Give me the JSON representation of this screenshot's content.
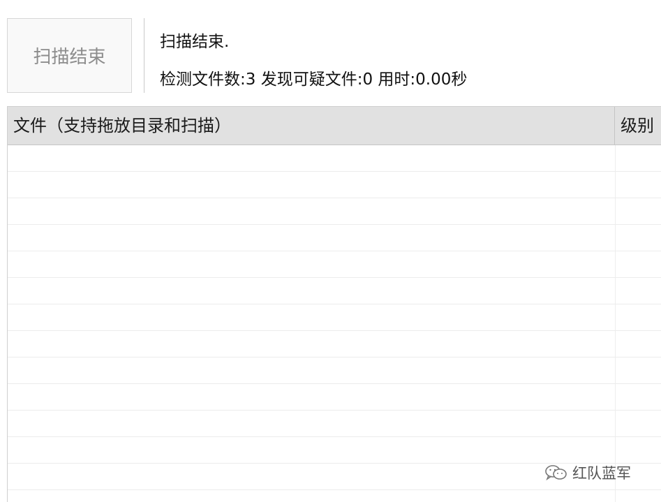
{
  "scan_button": {
    "label": "扫描结束"
  },
  "status": {
    "title": "扫描结束.",
    "stats": "检测文件数:3 发现可疑文件:0 用时:0.00秒"
  },
  "table": {
    "columns": [
      "文件（支持拖放目录和扫描）",
      "级别"
    ],
    "rows": []
  },
  "watermark": {
    "text": "红队蓝军",
    "icon": "wechat-icon"
  }
}
